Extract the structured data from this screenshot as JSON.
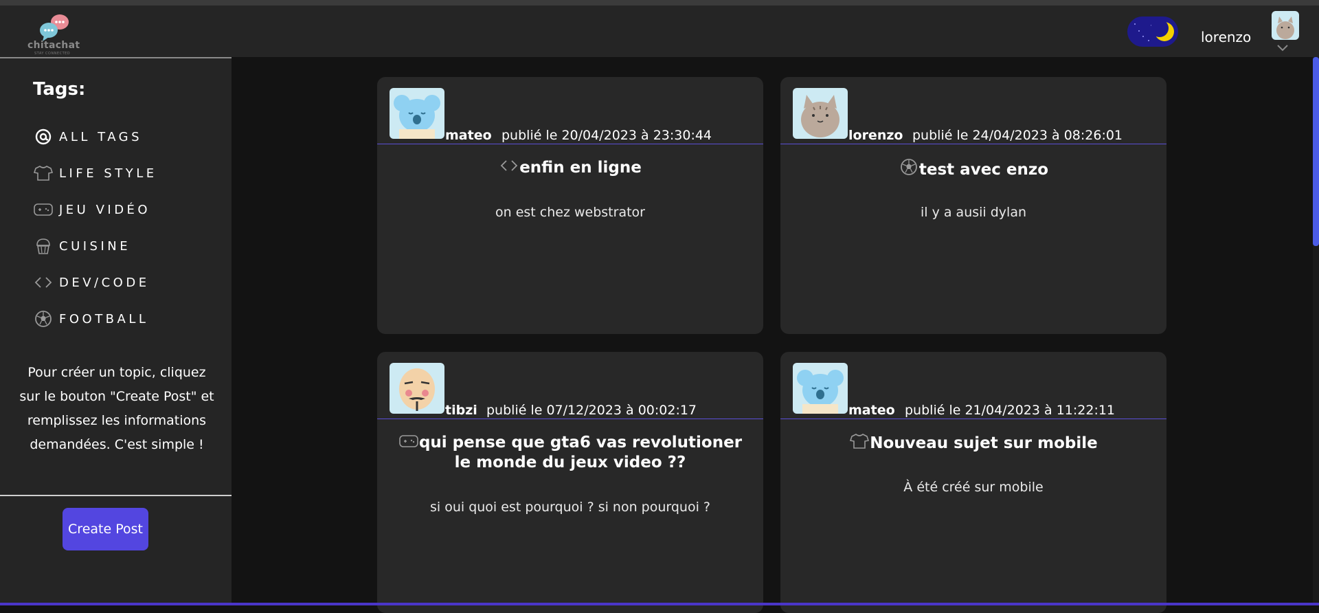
{
  "app": {
    "logo_text": "chitachat",
    "logo_sub": "STAY CONNECTED",
    "username": "lorenzo"
  },
  "sidebar": {
    "title": "Tags:",
    "tags": [
      {
        "label": "ALL TAGS",
        "icon": "at-icon"
      },
      {
        "label": "LIFE STYLE",
        "icon": "tshirt-icon"
      },
      {
        "label": "JEU VIDÉO",
        "icon": "gamepad-icon"
      },
      {
        "label": "CUISINE",
        "icon": "cupcake-icon"
      },
      {
        "label": "DEV/CODE",
        "icon": "code-icon"
      },
      {
        "label": "FOOTBALL",
        "icon": "football-icon"
      }
    ],
    "help": "Pour créer un topic, cliquez sur le bouton \"Create Post\" et remplissez les informations demandées. C'est simple !",
    "create_button": "Create Post"
  },
  "posts": [
    {
      "author": "mateo",
      "date": "publié le 20/04/2023 à 23:30:44",
      "tag_icon": "code-icon",
      "title": "enfin en ligne",
      "body": "on est chez webstrator",
      "avatar": "koala-avatar"
    },
    {
      "author": "lorenzo",
      "date": "publié le 24/04/2023 à 08:26:01",
      "tag_icon": "football-icon",
      "title": "test avec enzo",
      "body": "il y a ausii dylan",
      "avatar": "cat-avatar"
    },
    {
      "author": "tibzi",
      "date": "publié le 07/12/2023 à 00:02:17",
      "tag_icon": "gamepad-icon",
      "title": "qui pense que gta6 vas revolutioner le monde du jeux video ??",
      "body": "si oui quoi est pourquoi ? si non pourquoi ?",
      "avatar": "mask-avatar"
    },
    {
      "author": "mateo",
      "date": "publié le 21/04/2023 à 11:22:11",
      "tag_icon": "tshirt-icon",
      "title": "Nouveau sujet sur mobile",
      "body": "À été créé sur mobile",
      "avatar": "koala-avatar"
    }
  ],
  "colors": {
    "accent": "#5346e0",
    "background": "#131313",
    "panel": "#252525",
    "card": "#282828"
  }
}
